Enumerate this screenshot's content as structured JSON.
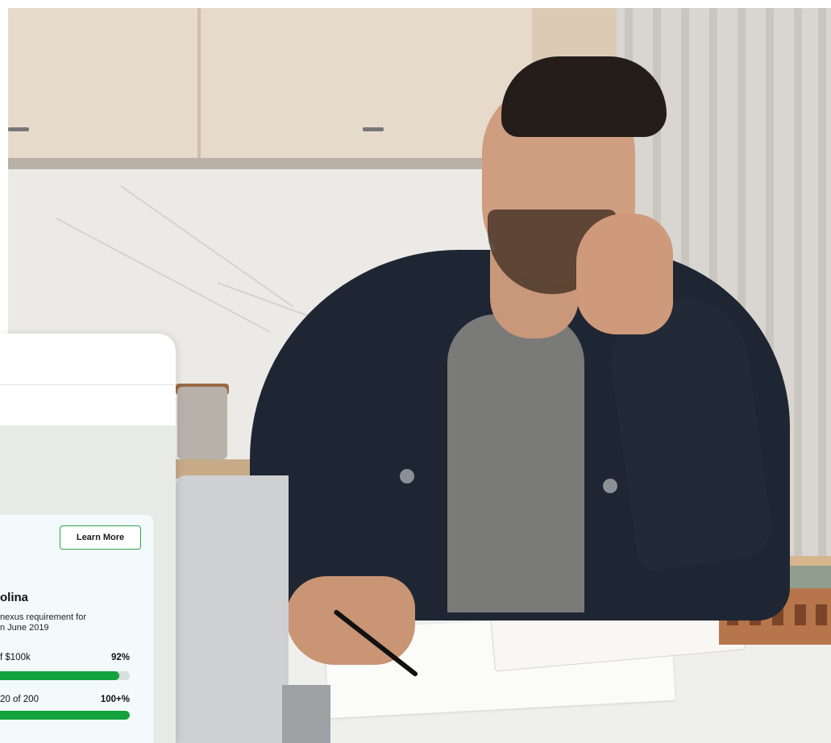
{
  "card": {
    "learn_more_label": "Learn More",
    "state_name": "olina",
    "description": "nexus requirement for\nn June 2019",
    "metrics": [
      {
        "label": "f $100k",
        "percent_label": "92%",
        "progress": 0.92
      },
      {
        "label": "20 of 200",
        "percent_label": "100+%",
        "progress": 1.0
      }
    ],
    "colors": {
      "accent": "#14a23d",
      "button_border": "#2aa84a"
    }
  }
}
